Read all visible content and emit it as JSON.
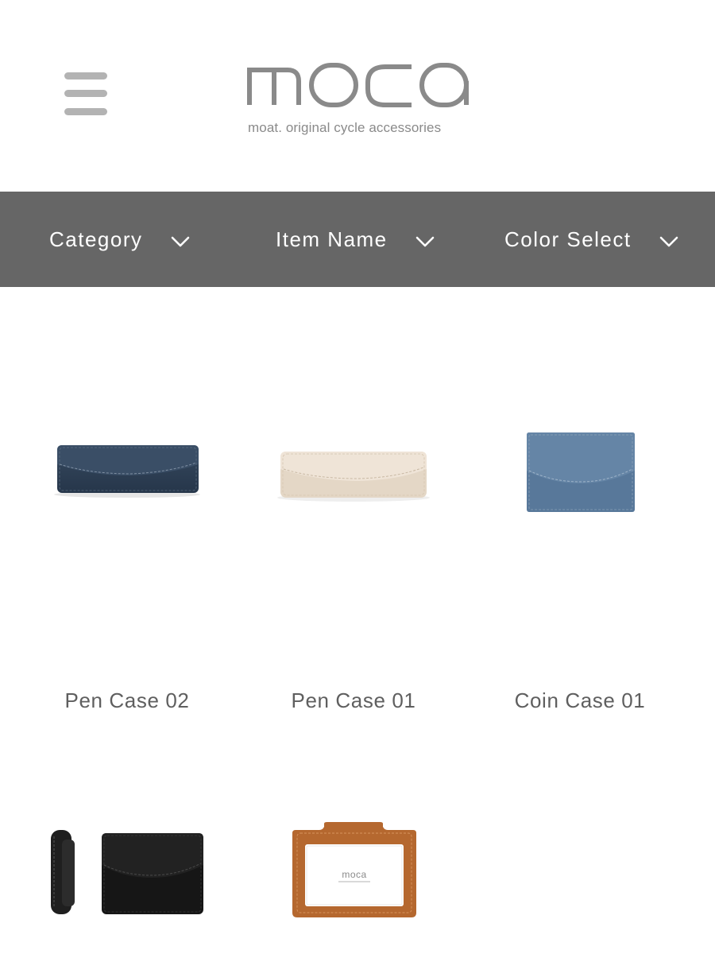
{
  "header": {
    "menu_icon": "hamburger-menu-icon",
    "logo_text": "moca",
    "tagline": "moat. original cycle accessories"
  },
  "filters": [
    {
      "label": "Category",
      "icon": "chevron-down-icon"
    },
    {
      "label": "Item Name",
      "icon": "chevron-down-icon"
    },
    {
      "label": "Color Select",
      "icon": "chevron-down-icon"
    }
  ],
  "products": [
    {
      "name": "Pen Case 02",
      "color": "#2f4257"
    },
    {
      "name": "Pen Case 01",
      "color": "#ece1d4"
    },
    {
      "name": "Coin Case 01",
      "color": "#5f7e9a"
    },
    {
      "name": "",
      "color": "#1d1d1d"
    },
    {
      "name": "",
      "color": "#b86a32",
      "image_logo_text": "moca"
    }
  ],
  "colors": {
    "filter_bar": "#666666",
    "text": "#5f5f5f",
    "logo": "#8a8a8a",
    "hamburger": "#b3b3b3"
  }
}
